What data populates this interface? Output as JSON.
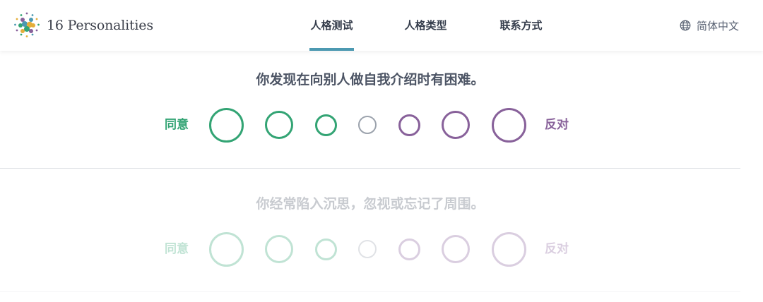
{
  "brand": {
    "name": "16 Personalities"
  },
  "nav": {
    "items": [
      "人格测试",
      "人格类型",
      "联系方式"
    ],
    "active_index": 0
  },
  "language": {
    "label": "简体中文"
  },
  "questions": [
    {
      "text": "你发现在向别人做自我介绍时有困难。",
      "agree_label": "同意",
      "disagree_label": "反对",
      "state": "active"
    },
    {
      "text": "你经常陷入沉思，忽视或忘记了周围。",
      "agree_label": "同意",
      "disagree_label": "反对",
      "state": "dimmed"
    }
  ],
  "colors": {
    "agree": "#33a474",
    "neutral": "#9ca3ad",
    "disagree": "#88619a",
    "nav_underline": "#4c99b1"
  }
}
